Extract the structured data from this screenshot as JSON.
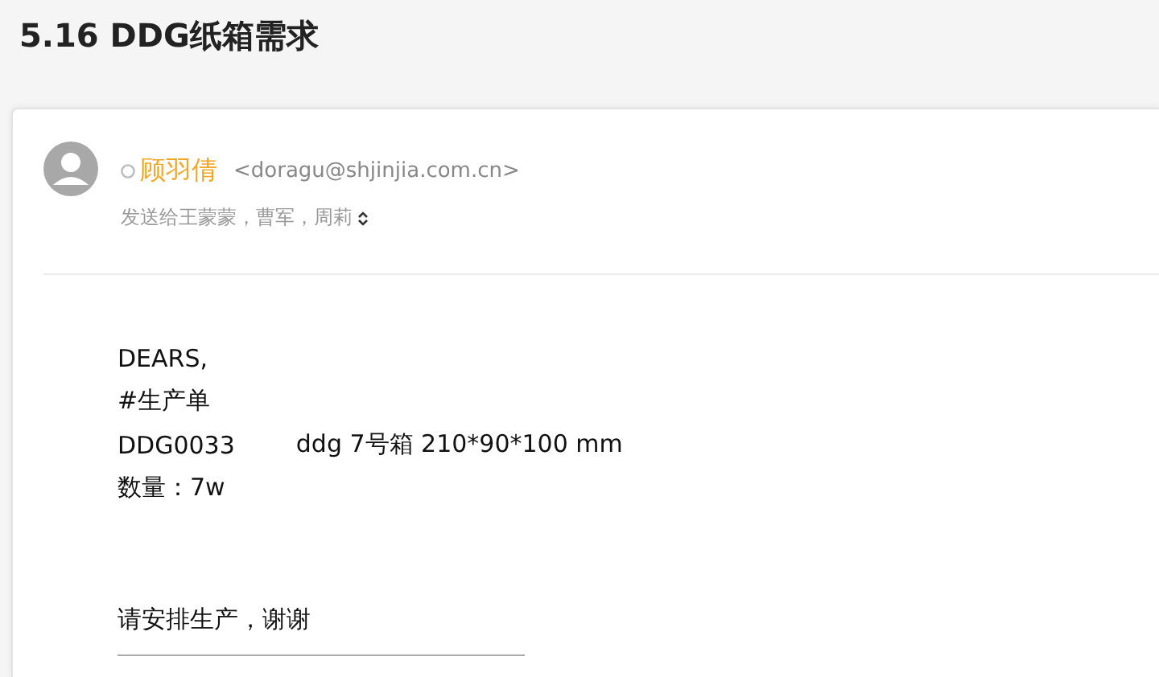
{
  "subject": "5.16 DDG纸箱需求",
  "sender": {
    "name": "顾羽倩",
    "email": "<doragu@shjinjia.com.cn>",
    "online": false
  },
  "recipients": "发送给王蒙蒙，曹军，周莉",
  "body": [
    {
      "kind": "line",
      "parts": [
        "DEARS,"
      ]
    },
    {
      "kind": "line",
      "parts": [
        "#生产单"
      ]
    },
    {
      "kind": "line",
      "parts": [
        "DDG0033",
        "ddg 7号箱 210*90*100 mm"
      ]
    },
    {
      "kind": "line",
      "parts": [
        "数量：7w"
      ]
    },
    {
      "kind": "gap"
    },
    {
      "kind": "line",
      "parts": [
        "请安排生产，谢谢"
      ]
    },
    {
      "kind": "rule"
    }
  ]
}
